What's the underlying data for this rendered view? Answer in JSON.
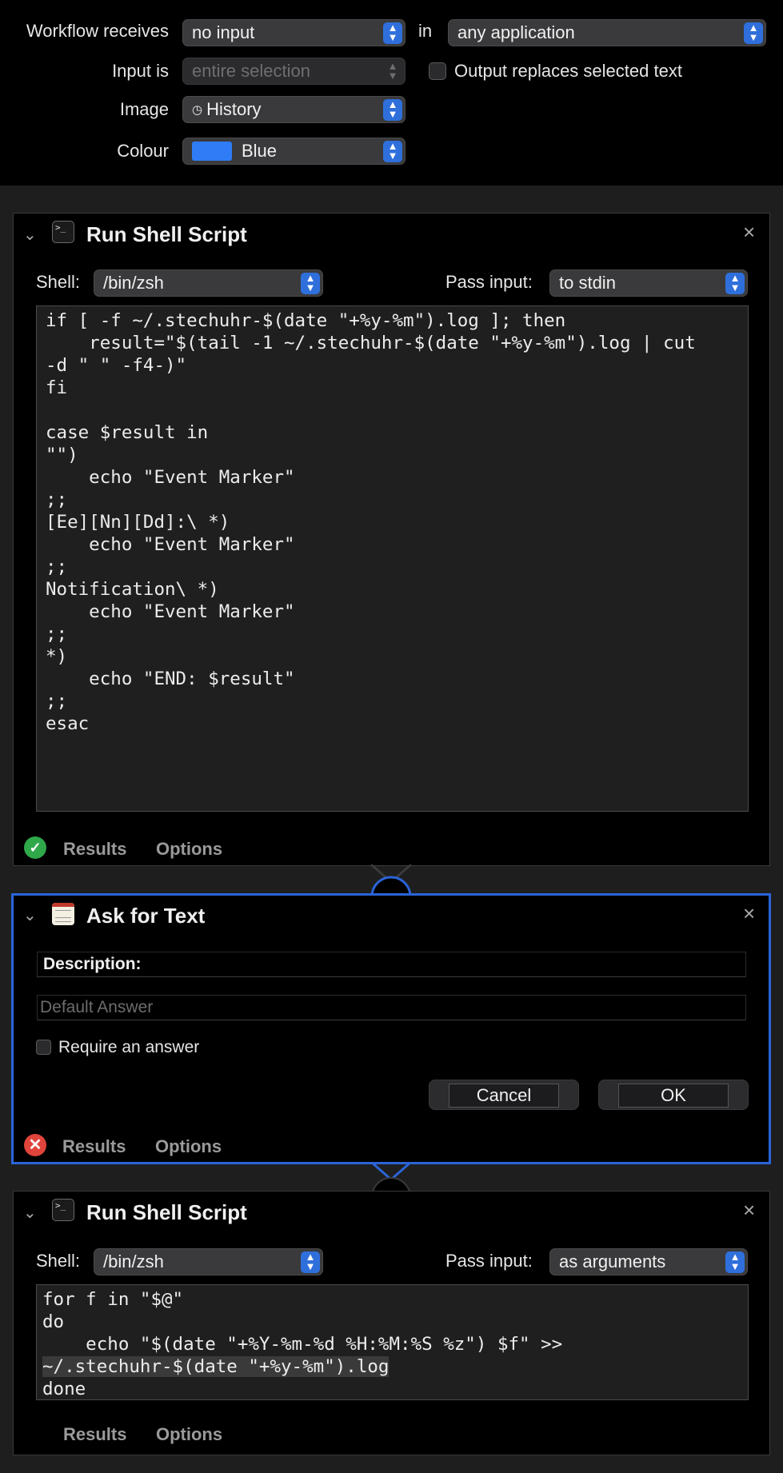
{
  "workflow": {
    "receives_label": "Workflow receives",
    "receives_value": "no input",
    "in_label": "in",
    "app_value": "any application",
    "input_is_label": "Input is",
    "input_is_value": "entire selection",
    "output_replaces_label": "Output replaces selected text",
    "image_label": "Image",
    "image_value": "History",
    "image_icon": "clock-icon",
    "colour_label": "Colour",
    "colour_value": "Blue",
    "colour_hex": "#2f7cf6"
  },
  "actions": [
    {
      "title": "Run Shell Script",
      "shell_label": "Shell:",
      "shell_value": "/bin/zsh",
      "pass_input_label": "Pass input:",
      "pass_input_value": "to stdin",
      "code": "if [ -f ~/.stechuhr-$(date \"+%y-%m\").log ]; then\n    result=\"$(tail -1 ~/.stechuhr-$(date \"+%y-%m\").log | cut\n-d \" \" -f4-)\"\nfi\n\ncase $result in\n\"\")\n    echo \"Event Marker\"\n;;\n[Ee][Nn][Dd]:\\ *)\n    echo \"Event Marker\"\n;;\nNotification\\ *)\n    echo \"Event Marker\"\n;;\n*)\n    echo \"END: $result\"\n;;\nesac",
      "results_tab": "Results",
      "options_tab": "Options",
      "status": "success"
    },
    {
      "title": "Ask for Text",
      "description_label": "Description:",
      "default_answer_placeholder": "Default Answer",
      "require_answer_label": "Require an answer",
      "cancel_label": "Cancel",
      "ok_label": "OK",
      "results_tab": "Results",
      "options_tab": "Options",
      "status": "error"
    },
    {
      "title": "Run Shell Script",
      "shell_label": "Shell:",
      "shell_value": "/bin/zsh",
      "pass_input_label": "Pass input:",
      "pass_input_value": "as arguments",
      "code_line1": "for f in \"$@\"",
      "code_line2": "do",
      "code_line3": "    echo \"$(date \"+%Y-%m-%d %H:%M:%S %z\") $f\" >>",
      "code_line4": "~/.stechuhr-$(date \"+%y-%m\").log",
      "code_line5": "done",
      "results_tab": "Results",
      "options_tab": "Options"
    }
  ]
}
